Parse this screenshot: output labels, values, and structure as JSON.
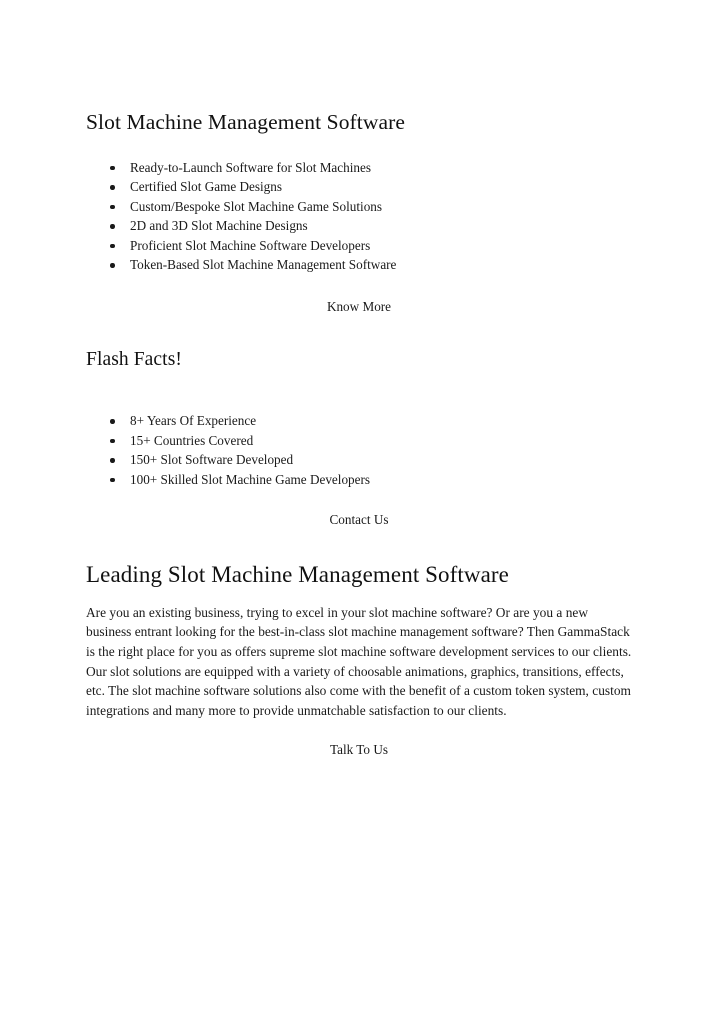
{
  "document": {
    "background_color": "#ffffff",
    "text_color": "#1a1a1a"
  },
  "sections": {
    "slot_machine": {
      "heading": "Slot Machine Management Software",
      "bullets": [
        "Ready-to-Launch Software for Slot Machines",
        "Certified Slot Game Designs",
        "Custom/Bespoke Slot Machine Game Solutions",
        "2D and 3D Slot Machine Designs",
        "Proficient Slot Machine Software Developers",
        "Token-Based Slot Machine Management Software"
      ],
      "cta": "Know More"
    },
    "flash_facts": {
      "heading": "Flash Facts!",
      "bullets": [
        "8+ Years Of Experience",
        "15+ Countries Covered",
        "150+ Slot Software Developed",
        "100+ Skilled Slot Machine Game Developers"
      ],
      "cta": "Contact Us"
    },
    "leading": {
      "heading": "Leading Slot Machine Management Software",
      "paragraph": "Are you an existing business, trying to excel in your slot machine software? Or are you a new business entrant looking for the best-in-class slot machine management software? Then GammaStack is the right place for you as offers supreme slot machine software development services to our clients. Our slot solutions are equipped with a variety of choosable animations, graphics, transitions, effects, etc. The slot machine software solutions also come with the benefit of a custom token system, custom integrations and many more to provide unmatchable satisfaction to our clients.",
      "cta": "Talk To Us"
    }
  }
}
